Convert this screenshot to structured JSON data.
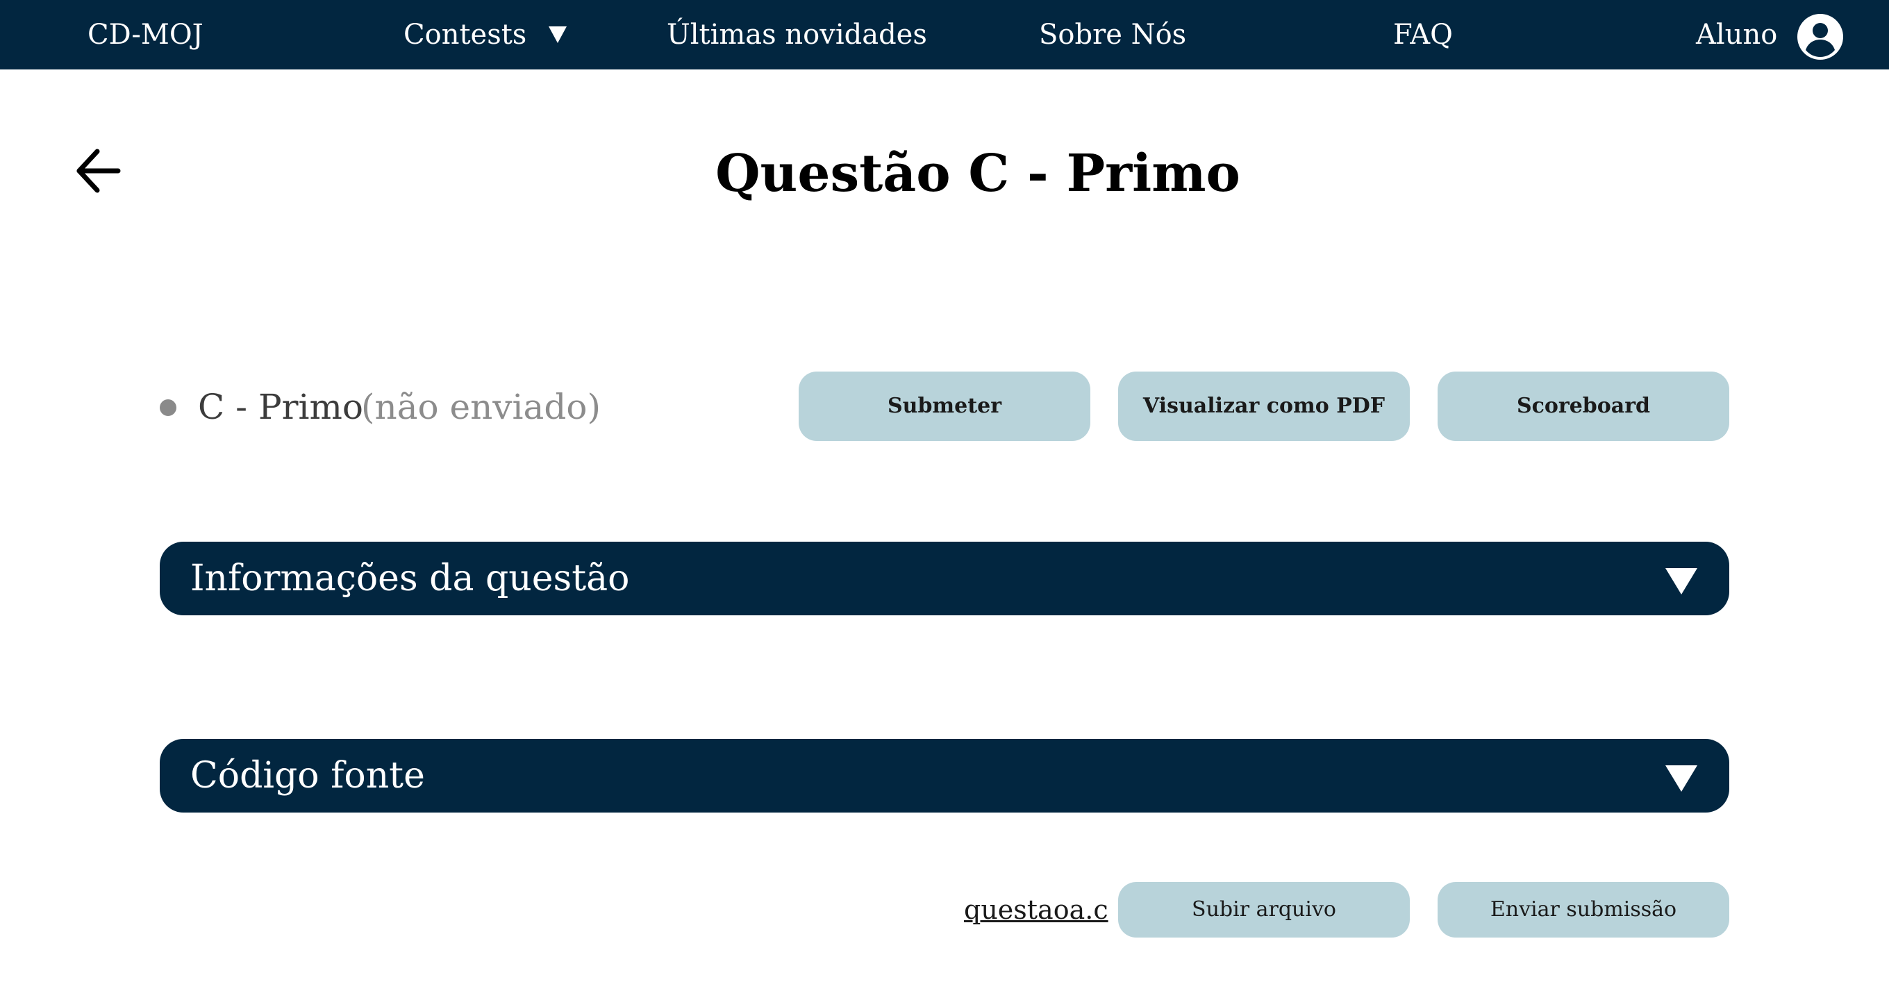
{
  "navbar": {
    "brand": "CD-MOJ",
    "contests": "Contests",
    "news": "Últimas novidades",
    "about": "Sobre Nós",
    "faq": "FAQ",
    "user": "Aluno",
    "icons": {
      "contests_dropdown": "caret-down-icon",
      "user": "user-circle-icon"
    }
  },
  "page": {
    "title": "Questão C - Primo",
    "back_icon": "arrow-left-icon"
  },
  "problem": {
    "name": "C - Primo",
    "status": "(não enviado)",
    "actions": {
      "submit": "Submeter",
      "pdf": "Visualizar como PDF",
      "scoreboard": "Scoreboard"
    }
  },
  "sections": {
    "info": "Informações da questão",
    "source": "Código fonte"
  },
  "upload": {
    "file_name": "questaoa.c",
    "upload_button": "Subir arquivo",
    "send_button": "Enviar submissão"
  },
  "colors": {
    "navbar_bg": "#022640",
    "button_bg": "#b8d3da",
    "status_dot": "#8a8a8a"
  }
}
